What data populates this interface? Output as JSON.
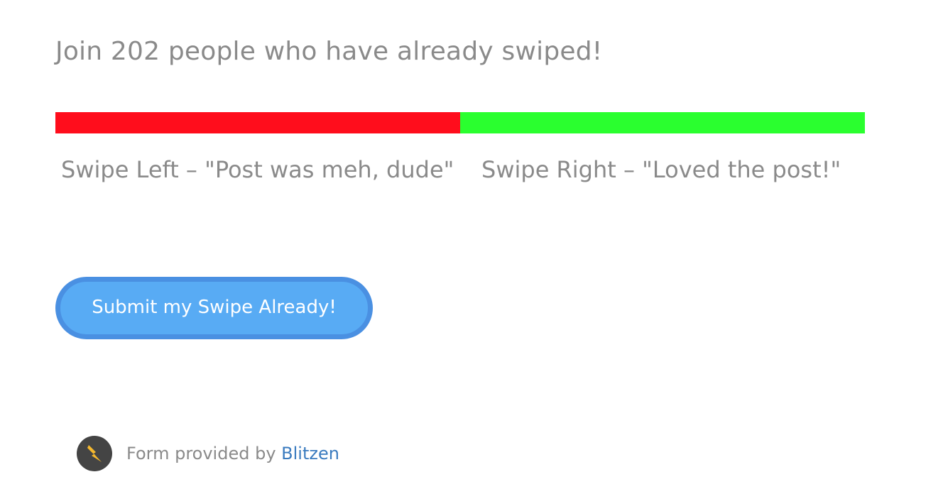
{
  "headline": {
    "text": "Join 202 people who have already swiped!"
  },
  "swipe_bar": {
    "left_color": "#ff0d1c",
    "right_color": "#2aff2f",
    "left_share": 0.5,
    "right_share": 0.5
  },
  "options": {
    "left_label": "Swipe Left – \"Post was meh, dude\"",
    "right_label": "Swipe Right – \"Loved the post!\""
  },
  "submit": {
    "label": "Submit my Swipe Already!",
    "color": "#58abf4",
    "border_color": "#4a90e2"
  },
  "footer": {
    "prefix": "Form provided by ",
    "link_text": "Blitzen",
    "icon": "lightning-bolt-icon",
    "icon_color": "#f5b82e"
  }
}
